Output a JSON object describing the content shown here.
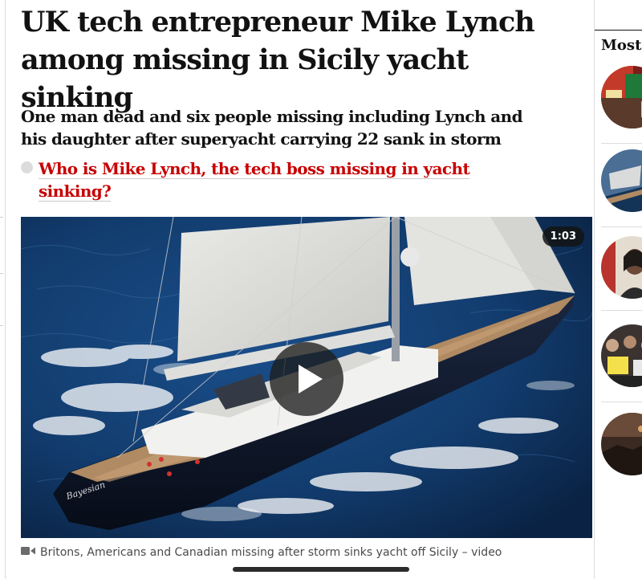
{
  "article": {
    "headline": "UK tech entrepreneur Mike Lynch among missing in Sicily yacht sinking",
    "standfirst": "One man dead and six people missing including Lynch and his daughter after superyacht carrying 22 sank in storm",
    "related_link": "Who is Mike Lynch, the tech boss missing in yacht sinking?"
  },
  "video": {
    "duration": "1:03",
    "boat_name": "Bayesian",
    "caption": "Britons, Americans and Canadian missing after storm sinks yacht off Sicily – video",
    "icon": "video-camera-icon"
  },
  "sidebar": {
    "heading": "Most v",
    "thumbnails": [
      "news-thumb-protest",
      "news-thumb-yacht",
      "news-thumb-portrait",
      "news-thumb-crowd",
      "news-thumb-night"
    ]
  },
  "colors": {
    "link_red": "#c70000",
    "text": "#121212",
    "sea": "#0d2d57"
  }
}
